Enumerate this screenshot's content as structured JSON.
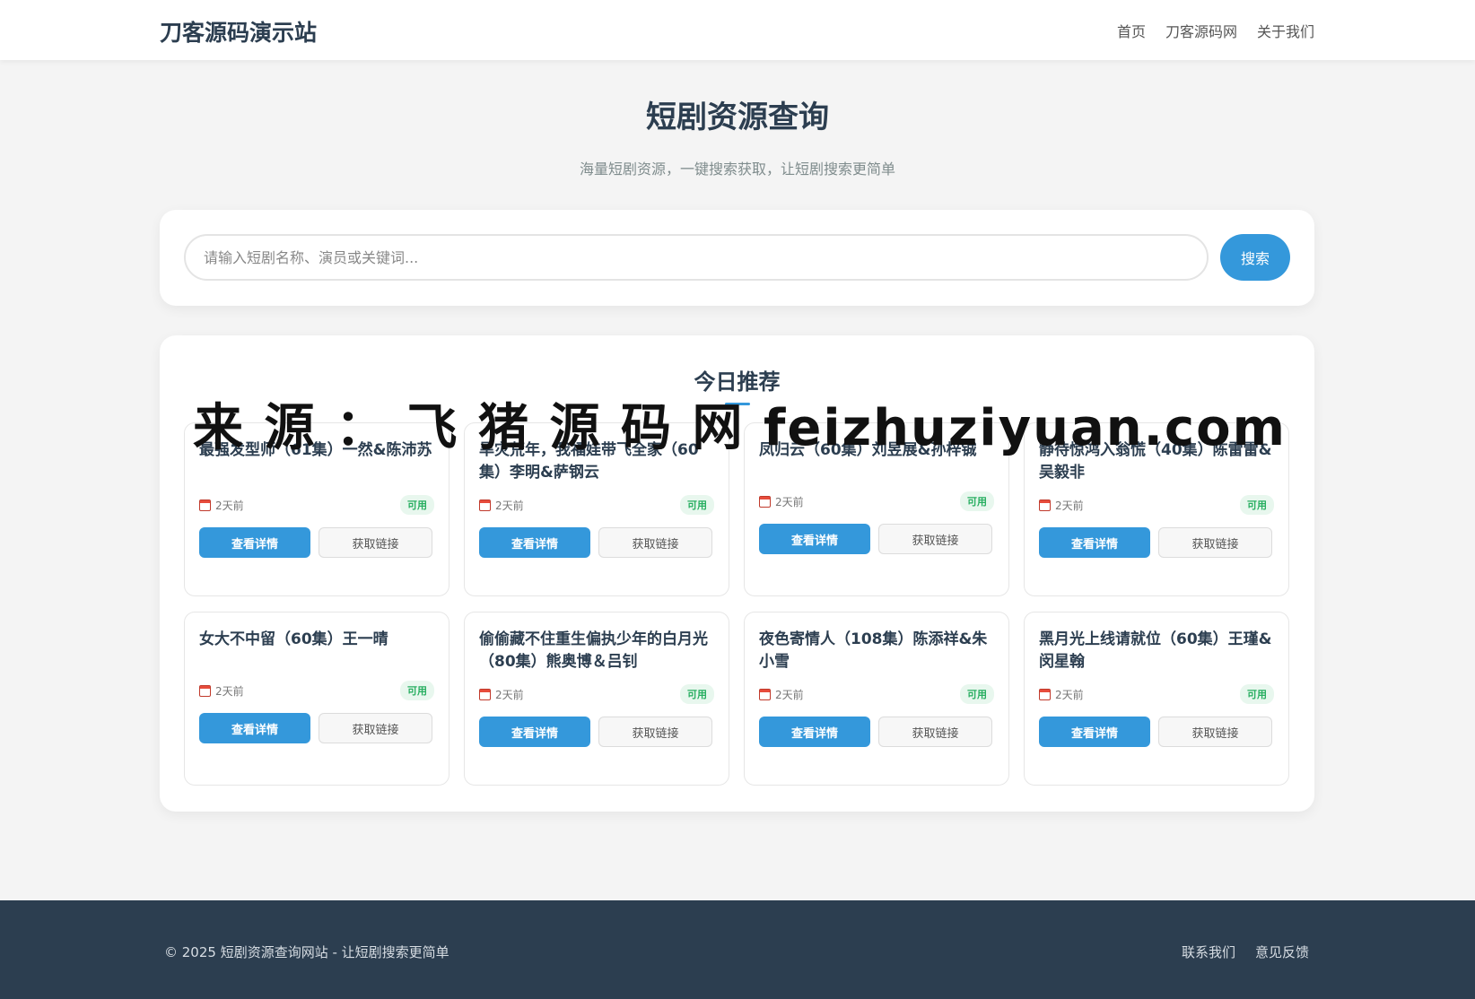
{
  "header": {
    "brand": "刀客源码演示站",
    "nav": [
      "首页",
      "刀客源码网",
      "关于我们"
    ]
  },
  "hero": {
    "title": "短剧资源查询",
    "subtitle": "海量短剧资源，一键搜索获取，让短剧搜索更简单"
  },
  "search": {
    "placeholder": "请输入短剧名称、演员或关键词...",
    "value": "",
    "button": "搜索"
  },
  "recommend": {
    "title": "今日推荐",
    "items": [
      {
        "title": "最强发型师（61集）一然&陈沛苏",
        "time": "2天前",
        "status": "可用",
        "detail": "查看详情",
        "link": "获取链接"
      },
      {
        "title": "旱灾荒年，我福娃带飞全家（60集）李明&萨钢云",
        "time": "2天前",
        "status": "可用",
        "detail": "查看详情",
        "link": "获取链接"
      },
      {
        "title": "凤归云（60集）刘昱展&孙梓铖",
        "time": "2天前",
        "status": "可用",
        "detail": "查看详情",
        "link": "获取链接"
      },
      {
        "title": "静待惊鸿入翁慌（40集）陈雷雷&吴毅非",
        "time": "2天前",
        "status": "可用",
        "detail": "查看详情",
        "link": "获取链接"
      },
      {
        "title": "女大不中留（60集）王一晴",
        "time": "2天前",
        "status": "可用",
        "detail": "查看详情",
        "link": "获取链接"
      },
      {
        "title": "偷偷藏不住重生偏执少年的白月光（80集）熊奥博＆吕钊",
        "time": "2天前",
        "status": "可用",
        "detail": "查看详情",
        "link": "获取链接"
      },
      {
        "title": "夜色寄情人（108集）陈添祥&朱小雪",
        "time": "2天前",
        "status": "可用",
        "detail": "查看详情",
        "link": "获取链接"
      },
      {
        "title": "黑月光上线请就位（60集）王瑾&闵星翰",
        "time": "2天前",
        "status": "可用",
        "detail": "查看详情",
        "link": "获取链接"
      }
    ]
  },
  "watermark": "来 源 ： 飞 猪 源 码 网 feizhuziyuan.com",
  "footer": {
    "copyright": "© 2025 短剧资源查询网站 - 让短剧搜索更简单",
    "links": [
      "联系我们",
      "意见反馈"
    ]
  },
  "colors": {
    "accent": "#3498db",
    "footer_bg": "#2c3e50",
    "available": "#27ae60"
  },
  "icons": {
    "date": "calendar-icon"
  }
}
